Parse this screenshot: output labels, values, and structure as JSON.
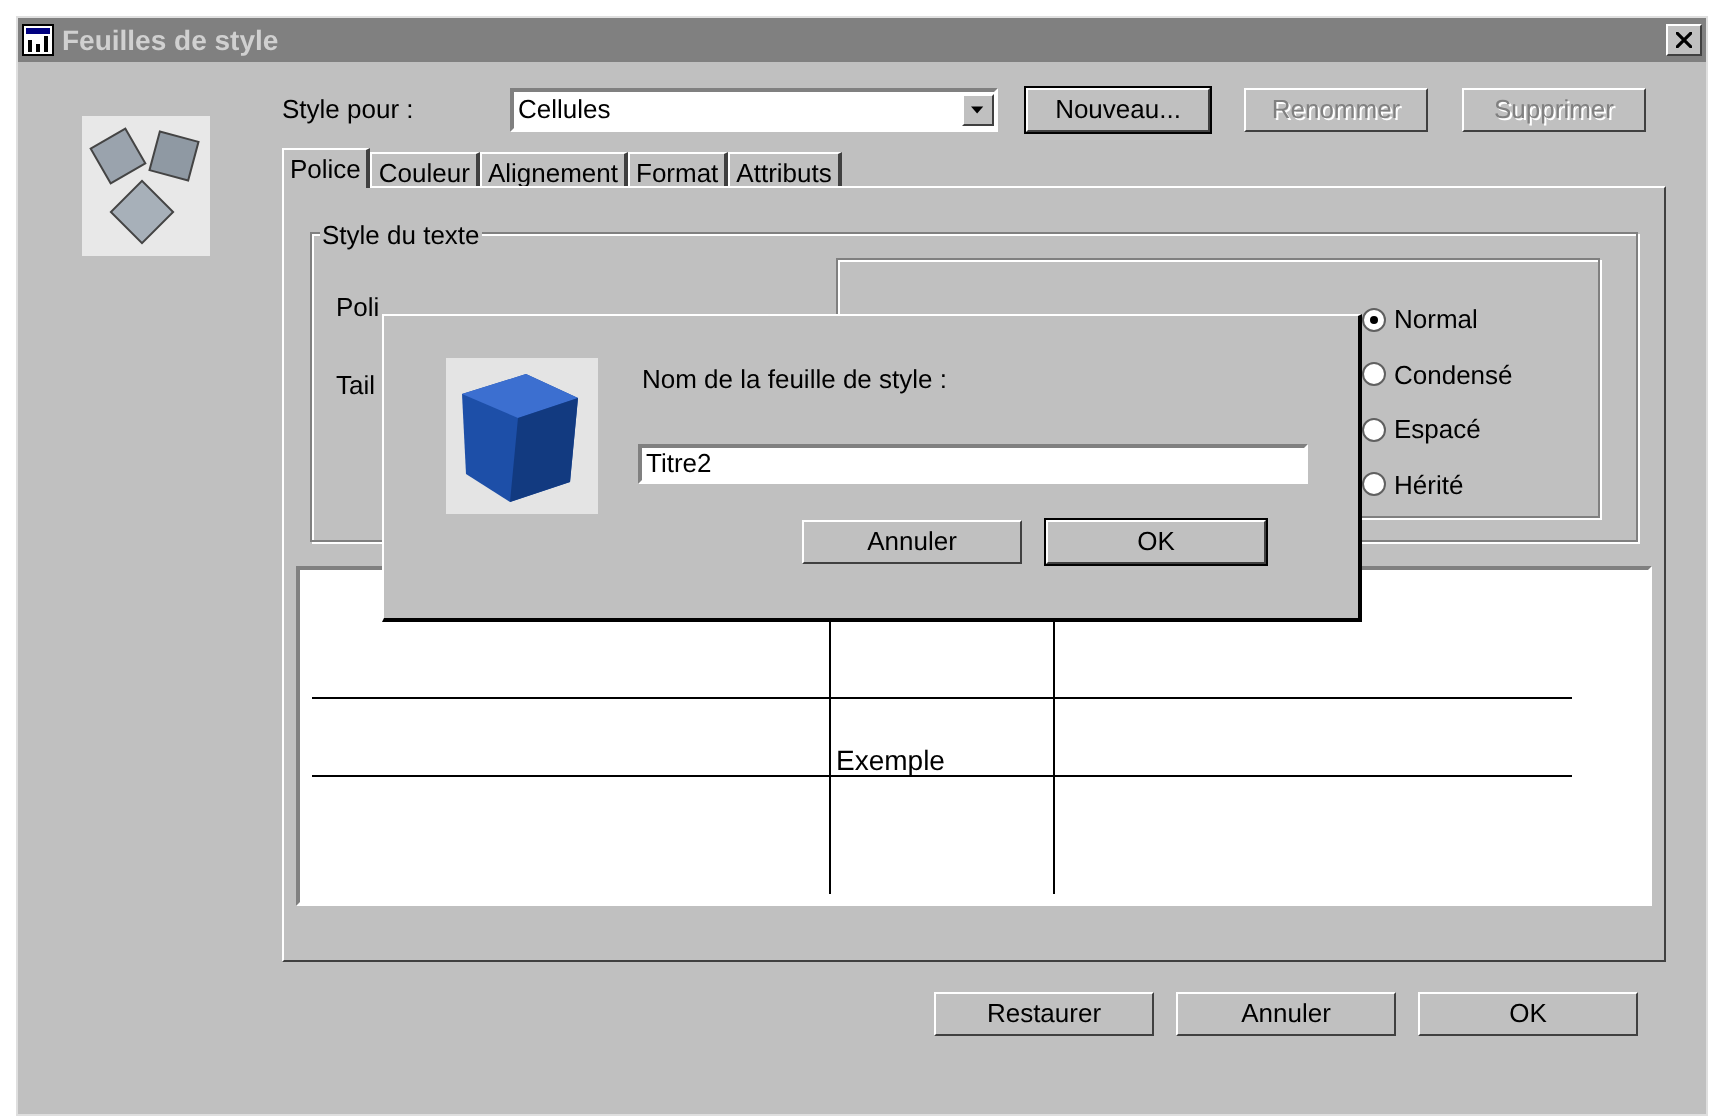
{
  "window": {
    "title": "Feuilles de style"
  },
  "style_for": {
    "label": "Style pour :",
    "value": "Cellules"
  },
  "buttons": [
    {
      "label": "Nouveau...",
      "disabled": false
    },
    {
      "label": "Renommer",
      "disabled": true
    },
    {
      "label": "Supprimer",
      "disabled": true
    }
  ],
  "tabs": [
    {
      "label": "Police",
      "selected": true
    },
    {
      "label": "Couleur",
      "selected": false
    },
    {
      "label": "Alignement",
      "selected": false
    },
    {
      "label": "Format",
      "selected": false
    },
    {
      "label": "Attributs",
      "selected": false
    }
  ],
  "group": {
    "title": "Style du texte",
    "labels": [
      "Poli",
      "Tail"
    ],
    "radios": [
      {
        "label": "Normal",
        "selected": true
      },
      {
        "label": "Condensé",
        "selected": false
      },
      {
        "label": "Espacé",
        "selected": false
      },
      {
        "label": "Hérité",
        "selected": false
      }
    ]
  },
  "preview": {
    "text": "Exemple"
  },
  "footer_buttons": [
    "Restaurer",
    "Annuler",
    "OK"
  ],
  "dialog": {
    "label": "Nom de la feuille de style :",
    "value": "Titre2",
    "buttons": [
      "Annuler",
      "OK"
    ]
  }
}
